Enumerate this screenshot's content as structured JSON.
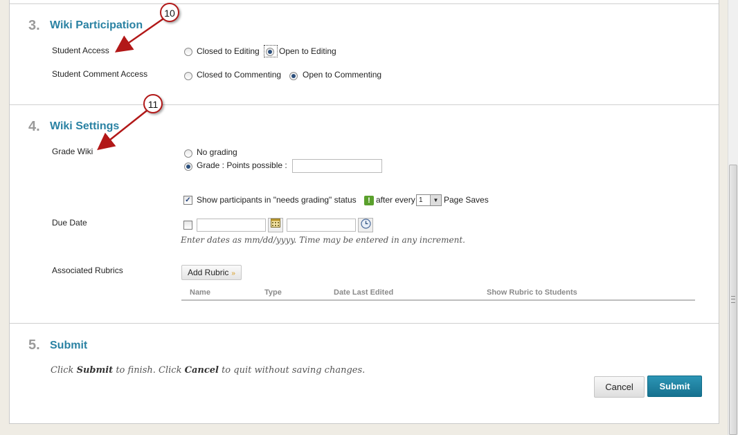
{
  "participation": {
    "step": "3.",
    "title": "Wiki Participation",
    "student_access": {
      "label": "Student Access",
      "options": [
        "Closed to Editing",
        "Open to Editing"
      ],
      "selected": "Open to Editing"
    },
    "comment_access": {
      "label": "Student Comment Access",
      "options": [
        "Closed to Commenting",
        "Open to Commenting"
      ],
      "selected": "Open to Commenting"
    }
  },
  "settings": {
    "step": "4.",
    "title": "Wiki Settings",
    "grade": {
      "label": "Grade Wiki",
      "no_grading": "No grading",
      "points_label": "Grade : Points possible :",
      "points_value": "",
      "selected": "Grade : Points possible :"
    },
    "needs_grading": {
      "checked": true,
      "label": "Show participants in \"needs grading\" status",
      "after": "after every",
      "count": "1",
      "suffix": "Page Saves"
    },
    "due_date": {
      "label": "Due Date",
      "checked": false,
      "date_value": "",
      "time_value": "",
      "hint": "Enter dates as mm/dd/yyyy. Time may be entered in any increment."
    },
    "rubrics": {
      "label": "Associated Rubrics",
      "add_button": "Add Rubric",
      "columns": [
        "Name",
        "Type",
        "Date Last Edited",
        "Show Rubric to Students"
      ]
    }
  },
  "submit": {
    "step": "5.",
    "title": "Submit",
    "text_pre": "Click ",
    "text_submit": "Submit",
    "text_mid": " to finish. Click ",
    "text_cancel": "Cancel",
    "text_post": " to quit without saving changes.",
    "cancel_label": "Cancel",
    "submit_label": "Submit"
  },
  "callouts": [
    "10",
    "11"
  ],
  "colors": {
    "accent": "#2a82a3",
    "submit_button": "#1a7b99",
    "callout_red": "#b21818"
  }
}
